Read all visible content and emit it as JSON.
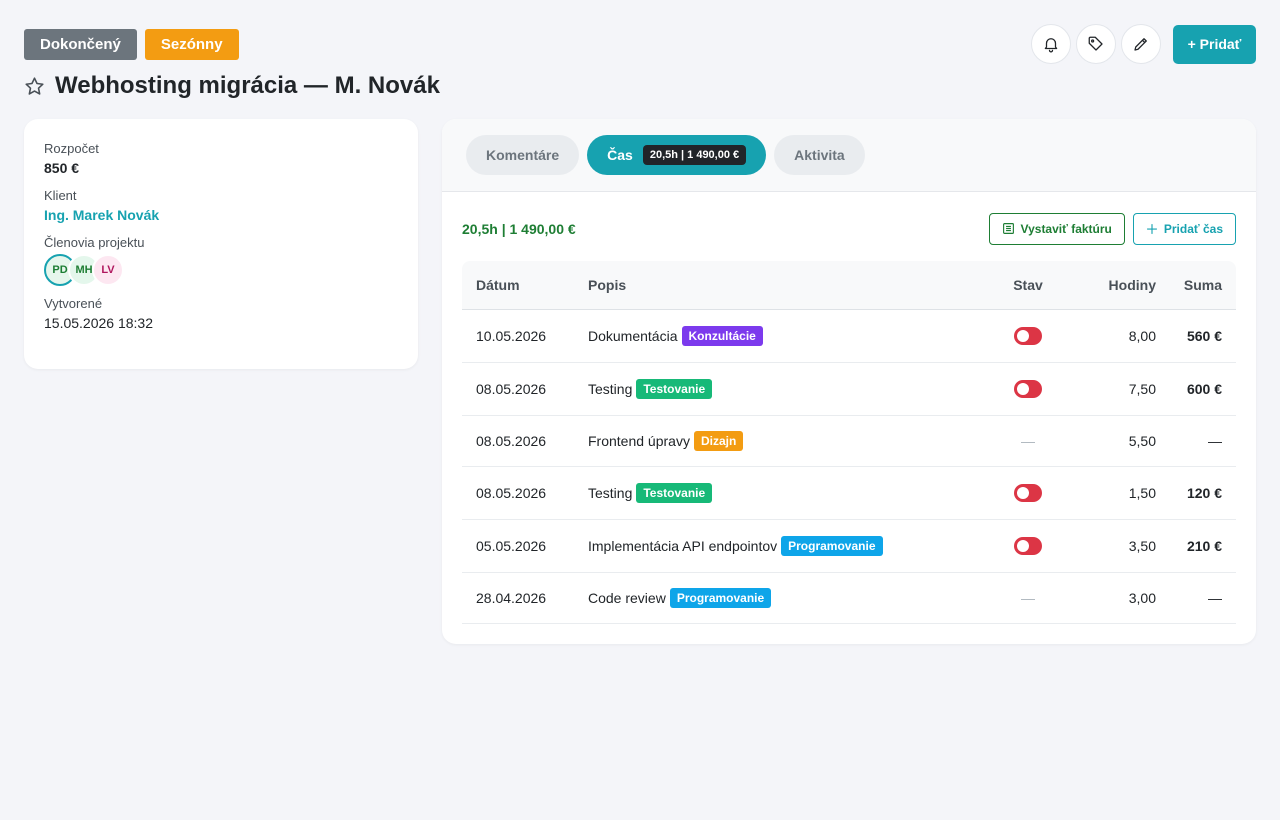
{
  "header": {
    "badges": [
      "Dokončený",
      "Sezónny"
    ],
    "title": "Webhosting migrácia — M. Novák",
    "add_label": "+ Pridať"
  },
  "icons": [
    "star-icon",
    "bell-icon",
    "tag-icon",
    "pencil-icon",
    "invoice-icon",
    "plus-icon",
    "toggle-switch"
  ],
  "colors": {
    "accent": "#17a2b0",
    "completed": "#6c757d",
    "seasonal": "#f39c12",
    "positive": "#1e7e34",
    "toggle_off": "#dc3545"
  },
  "info": {
    "budget_label": "Rozpočet",
    "budget_value": "850 €",
    "client_label": "Klient",
    "client_value": "Ing. Marek Novák",
    "members_label": "Členovia projektu",
    "members": [
      "PD",
      "MH",
      "LV"
    ],
    "created_label": "Vytvorené",
    "created_value": "15.05.2026 18:32"
  },
  "tabs": {
    "comments": "Komentáre",
    "time": "Čas",
    "time_pill": "20,5h | 1 490,00 €",
    "activity": "Aktivita"
  },
  "summary": {
    "total": "20,5h | 1 490,00 €",
    "invoice_label": "Vystaviť faktúru",
    "add_time_label": "Pridať čas"
  },
  "table": {
    "headers": {
      "date": "Dátum",
      "desc": "Popis",
      "status": "Stav",
      "hours": "Hodiny",
      "sum": "Suma"
    },
    "rows": [
      {
        "date": "10.05.2026",
        "desc": "Dokumentácia",
        "tag": "Konzultácie",
        "tag_color": "#7c3aed",
        "status": "toggle",
        "hours": "8,00",
        "sum": "560 €"
      },
      {
        "date": "08.05.2026",
        "desc": "Testing",
        "tag": "Testovanie",
        "tag_color": "#17b978",
        "status": "toggle",
        "hours": "7,50",
        "sum": "600 €"
      },
      {
        "date": "08.05.2026",
        "desc": "Frontend úpravy",
        "tag": "Dizajn",
        "tag_color": "#f39c12",
        "status": "—",
        "hours": "5,50",
        "sum": "—"
      },
      {
        "date": "08.05.2026",
        "desc": "Testing",
        "tag": "Testovanie",
        "tag_color": "#17b978",
        "status": "toggle",
        "hours": "1,50",
        "sum": "120 €"
      },
      {
        "date": "05.05.2026",
        "desc": "Implementácia API endpointov",
        "tag": "Programovanie",
        "tag_color": "#0ea5e9",
        "status": "toggle",
        "hours": "3,50",
        "sum": "210 €"
      },
      {
        "date": "28.04.2026",
        "desc": "Code review",
        "tag": "Programovanie",
        "tag_color": "#0ea5e9",
        "status": "—",
        "hours": "3,00",
        "sum": "—"
      }
    ]
  }
}
